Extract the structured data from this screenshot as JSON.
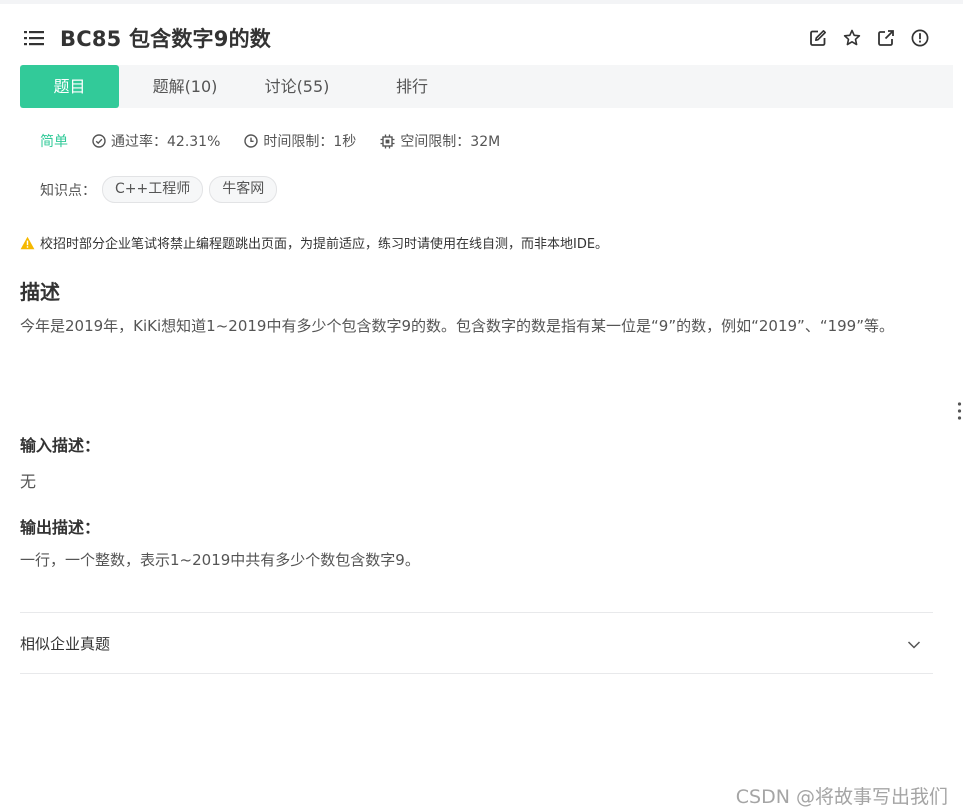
{
  "header": {
    "title": "BC85  包含数字9的数",
    "icons": [
      "menu-icon",
      "edit-icon",
      "star-icon",
      "external-link-icon",
      "info-icon"
    ]
  },
  "tabs": [
    {
      "label": "题目",
      "active": true
    },
    {
      "label": "题解(10)",
      "active": false
    },
    {
      "label": "讨论(55)",
      "active": false
    },
    {
      "label": "排行",
      "active": false
    }
  ],
  "meta": {
    "difficulty": "简单",
    "pass_rate": "通过率：42.31%",
    "time_limit": "时间限制：1秒",
    "space_limit": "空间限制：32M"
  },
  "knowledge": {
    "label": "知识点：",
    "tags": [
      "C++工程师",
      "牛客网"
    ]
  },
  "notice": "校招时部分企业笔试将禁止编程题跳出页面，为提前适应，练习时请使用在线自测，而非本地IDE。",
  "description": {
    "title": "描述",
    "text": "今年是2019年，KiKi想知道1~2019中有多少个包含数字9的数。包含数字的数是指有某一位是“9”的数，例如“2019”、“199”等。"
  },
  "input": {
    "title": "输入描述：",
    "text": "无"
  },
  "output": {
    "title": "输出描述：",
    "text": "一行，一个整数，表示1~2019中共有多少个数包含数字9。"
  },
  "similar": {
    "label": "相似企业真题"
  },
  "watermark": "CSDN @将故事写出我们",
  "colors": {
    "accent": "#32ca99",
    "warning": "#f5b800",
    "tab_bar_bg": "#f5f6f7"
  }
}
